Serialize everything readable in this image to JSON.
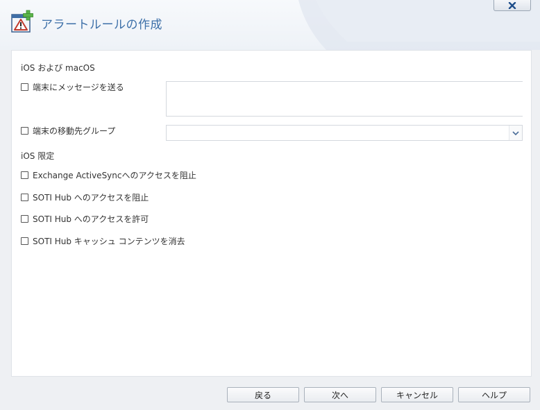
{
  "dialog": {
    "title": "アラートルールの作成",
    "icons": {
      "title": "alert-add-icon",
      "close": "close-icon",
      "dropdown": "chevron-down-icon"
    }
  },
  "sections": {
    "ios_macos": {
      "label": "iOS および macOS",
      "send_message_label": "端末にメッセージを送る",
      "message_value": "",
      "move_group_label": "端末の移動先グループ",
      "group_value": ""
    },
    "ios_only": {
      "label": "iOS 限定",
      "options": [
        "Exchange ActiveSyncへのアクセスを阻止",
        "SOTI Hub へのアクセスを阻止",
        "SOTI Hub へのアクセスを許可",
        "SOTI Hub キャッシュ コンテンツを消去"
      ]
    }
  },
  "footer": {
    "back_label": "戻る",
    "next_label": "次へ",
    "cancel_label": "キャンセル",
    "help_label": "ヘルプ"
  },
  "colors": {
    "title": "#3c6fa8",
    "panel_bg": "#ffffff",
    "window_bg": "#eef0f3",
    "icon_green": "#5bb34a",
    "icon_red": "#c0392b"
  }
}
